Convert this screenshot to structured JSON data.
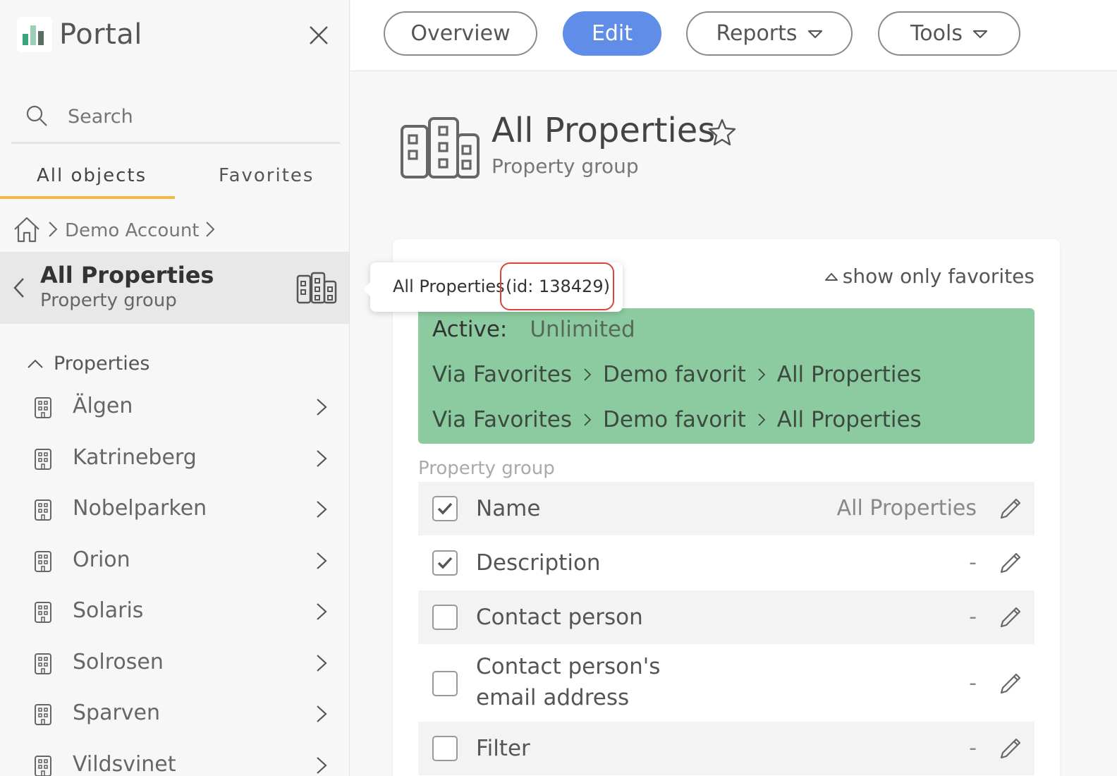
{
  "sidebar": {
    "brand": "Portal",
    "search_placeholder": "Search",
    "tabs": [
      "All objects",
      "Favorites"
    ],
    "breadcrumb": "Demo Account",
    "current": {
      "title": "All Properties",
      "subtitle": "Property group"
    },
    "section_title": "Properties",
    "items": [
      "Älgen",
      "Katrineberg",
      "Nobelparken",
      "Orion",
      "Solaris",
      "Solrosen",
      "Sparven",
      "Vildsvinet"
    ]
  },
  "topbar": {
    "buttons": [
      "Overview",
      "Edit",
      "Reports",
      "Tools"
    ],
    "active": "Edit",
    "accent_color": "#5f8de8"
  },
  "main": {
    "title": "All Properties",
    "subtitle": "Property group",
    "show_favorites": "show only favorites",
    "access": {
      "active_label": "Active:",
      "active_value": "Unlimited",
      "paths": [
        [
          "Via Favorites",
          "Demo favorit",
          "All Properties"
        ],
        [
          "Via Favorites",
          "Demo favorit",
          "All Properties"
        ]
      ],
      "color": "#8ccba0"
    },
    "section_label": "Property group",
    "fields": [
      {
        "label": "Name",
        "value": "All Properties",
        "checked": true
      },
      {
        "label": "Description",
        "value": "-",
        "checked": true
      },
      {
        "label": "Contact person",
        "value": "-",
        "checked": false
      },
      {
        "label": "Contact person's",
        "label2": "email address",
        "value": "-",
        "checked": false
      },
      {
        "label": "Filter",
        "value": "-",
        "checked": false
      }
    ]
  },
  "tooltip": {
    "name": "All Properties",
    "id_text": "(id: 138429)",
    "highlight_color": "#d9473a"
  }
}
